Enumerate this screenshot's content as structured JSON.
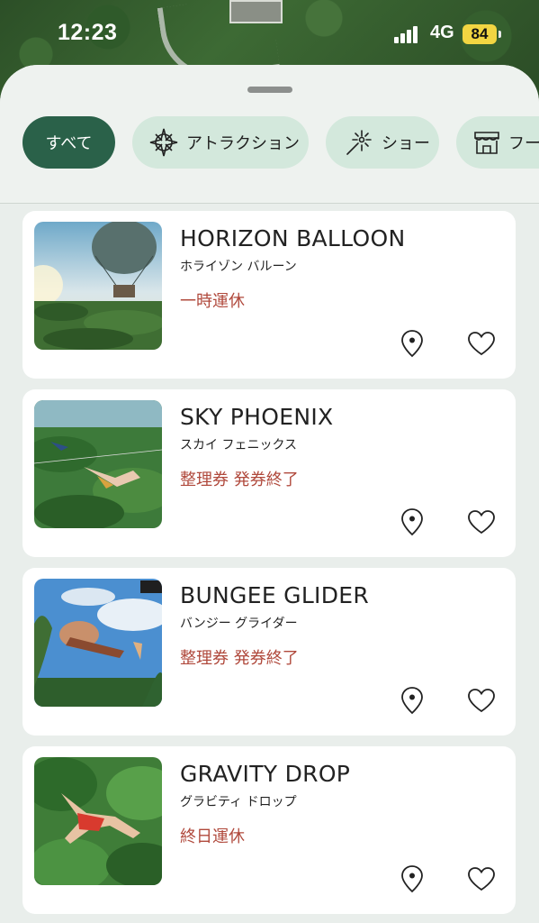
{
  "status_bar": {
    "time": "12:23",
    "network": "4G",
    "battery": "84"
  },
  "filters": [
    {
      "label": "すべて",
      "icon": "",
      "selected": true
    },
    {
      "label": "アトラクション",
      "icon": "compass-icon",
      "selected": false
    },
    {
      "label": "ショー",
      "icon": "sparkle-wand-icon",
      "selected": false
    },
    {
      "label": "フー",
      "icon": "storefront-icon",
      "selected": false
    }
  ],
  "items": [
    {
      "title": "HORIZON BALLOON",
      "subtitle": "ホライゾン バルーン",
      "status": "一時運休"
    },
    {
      "title": "SKY PHOENIX",
      "subtitle": "スカイ フェニックス",
      "status": "整理券 発券終了"
    },
    {
      "title": "BUNGEE GLIDER",
      "subtitle": "バンジー グライダー",
      "status": "整理券 発券終了"
    },
    {
      "title": "GRAVITY DROP",
      "subtitle": "グラビティ ドロップ",
      "status": "終日運休"
    }
  ],
  "colors": {
    "accent": "#2a6149",
    "chip_bg": "#d3e8dc",
    "status_red": "#b0493c"
  }
}
